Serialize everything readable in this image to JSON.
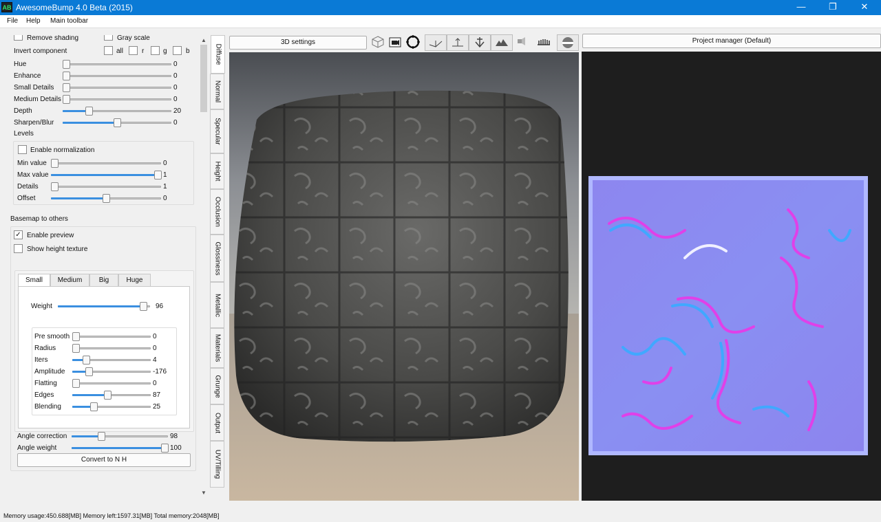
{
  "window": {
    "title": "AwesomeBump 4.0 Beta (2015)",
    "icon_text": "AB",
    "minimize": "—",
    "maximize": "❐",
    "close": "✕"
  },
  "menu": [
    "File",
    "Help",
    "Main toolbar"
  ],
  "panel": {
    "remove_shading": "Remove shading",
    "gray_scale": "Gray scale",
    "invert_component": "Invert component",
    "invert_opts": [
      "all",
      "r",
      "g",
      "b"
    ],
    "sliders_top": [
      {
        "label": "Hue",
        "value": "0",
        "pos": 0.0
      },
      {
        "label": "Enhance",
        "value": "0",
        "pos": 0.0
      },
      {
        "label": "Small Details",
        "value": "0",
        "pos": 0.0
      },
      {
        "label": "Medium Details",
        "value": "0",
        "pos": 0.0
      },
      {
        "label": "Depth",
        "value": "20",
        "pos": 0.22
      },
      {
        "label": "Sharpen/Blur",
        "value": "0",
        "pos": 0.5
      }
    ],
    "levels": "Levels",
    "enable_normalization": "Enable normalization",
    "levels_sliders": [
      {
        "label": "Min value",
        "value": "0",
        "pos": 0.0
      },
      {
        "label": "Max value",
        "value": "1",
        "pos": 1.0
      },
      {
        "label": "Details",
        "value": "1",
        "pos": 0.0
      },
      {
        "label": "Offset",
        "value": "0",
        "pos": 0.5
      }
    ],
    "basemap": "Basemap to others",
    "enable_preview": "Enable preview",
    "show_height": "Show height texture",
    "tabs": [
      "Small",
      "Medium",
      "Big",
      "Huge"
    ],
    "weight": {
      "label": "Weight",
      "value": "96",
      "pos": 0.96
    },
    "inner_sliders": [
      {
        "label": "Pre smooth",
        "value": "0",
        "pos": 0.0
      },
      {
        "label": "Radius",
        "value": "0",
        "pos": 0.0
      },
      {
        "label": "Iters",
        "value": "4",
        "pos": 0.14
      },
      {
        "label": "Amplitude",
        "value": "-176",
        "pos": 0.18
      },
      {
        "label": "Flatting",
        "value": "0",
        "pos": 0.0
      },
      {
        "label": "Edges",
        "value": "87",
        "pos": 0.44
      },
      {
        "label": "Blending",
        "value": "25",
        "pos": 0.25
      }
    ],
    "angle_correction": {
      "label": "Angle correction",
      "value": "98",
      "pos": 0.29
    },
    "angle_weight": {
      "label": "Angle weight",
      "value": "100",
      "pos": 1.0
    },
    "convert": "Convert to N H"
  },
  "vtabs": [
    "Diffuse",
    "Normal",
    "Specular",
    "Height",
    "Occlusion",
    "Glossiness",
    "Metallic",
    "Materials",
    "Grunge",
    "Output",
    "UV/Tilling"
  ],
  "toolbar": {
    "settings": "3D settings",
    "icons": [
      "cube-icon",
      "camera-icon",
      "target-icon",
      "normal-icon",
      "up-arrow-icon",
      "anchor-icon",
      "mountain-icon",
      "speaker-icon",
      "comb-icon",
      "sphere-icon"
    ]
  },
  "project_manager": "Project manager (Default)",
  "status": "Memory usage:450.688[MB] Memory left:1597.31[MB] Total memory:2048[MB]"
}
